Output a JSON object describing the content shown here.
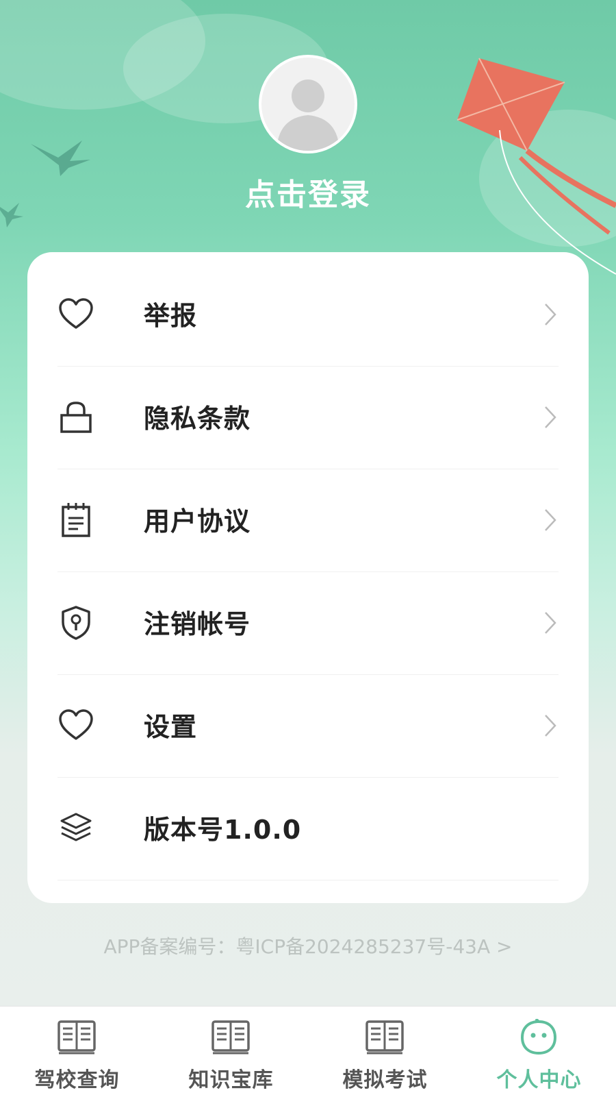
{
  "header": {
    "login_text": "点击登录"
  },
  "menu": {
    "items": [
      {
        "label": "举报",
        "icon": "heart-icon"
      },
      {
        "label": "隐私条款",
        "icon": "lock-icon"
      },
      {
        "label": "用户协议",
        "icon": "notepad-icon"
      },
      {
        "label": "注销帐号",
        "icon": "shield-keyhole-icon"
      },
      {
        "label": "设置",
        "icon": "heart-icon"
      },
      {
        "label": "版本号1.0.0",
        "icon": "layers-icon"
      }
    ]
  },
  "footer": {
    "icp_text": "APP备案编号：粤ICP备2024285237号-43A >"
  },
  "tabbar": {
    "tabs": [
      {
        "label": "驾校查询",
        "icon": "book-icon"
      },
      {
        "label": "知识宝库",
        "icon": "book-icon"
      },
      {
        "label": "模拟考试",
        "icon": "book-icon"
      },
      {
        "label": "个人中心",
        "icon": "smiley-icon",
        "active": true
      }
    ]
  },
  "colors": {
    "accent": "#5fbf9c",
    "header_green": "#6fcaa7",
    "kite": "#e8735f"
  }
}
